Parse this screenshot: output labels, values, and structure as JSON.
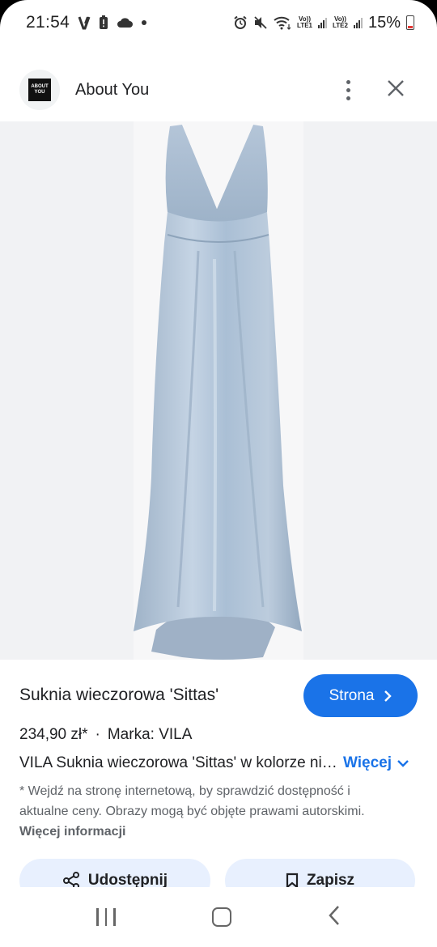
{
  "status_bar": {
    "time": "21:54",
    "left_icons": [
      "v-icon",
      "battery-alert-icon",
      "cloud-icon",
      "dot-icon"
    ],
    "right_icons": [
      "alarm-icon",
      "mute-icon",
      "wifi-icon",
      "signal-lte1",
      "signal-lte2",
      "battery-icon"
    ],
    "lte1_top": "Vo))",
    "lte1_bottom": "LTE1",
    "lte2_top": "Vo))",
    "lte2_bottom": "LTE2",
    "battery_percent": "15%"
  },
  "header": {
    "logo_text": "ABOUT YOU",
    "site_name": "About You",
    "more_icon": "more-vert-icon",
    "close_icon": "close-icon"
  },
  "product_image": {
    "subject": "dress",
    "color": "#a9bdd3"
  },
  "product": {
    "title": "Suknia wieczorowa 'Sittas'",
    "visit_label": "Strona",
    "price": "234,90 zł*",
    "separator": "·",
    "brand": "Marka: VILA",
    "description": "VILA Suknia wieczorowa 'Sittas' w kolorze niebieski",
    "more_label": "Więcej",
    "disclaimer": "* Wejdź na stronę internetową, by sprawdzić dostępność i aktualne ceny. Obrazy mogą być objęte prawami autorskimi.",
    "disclaimer_link": "Więcej informacji",
    "share_label": "Udostępnij",
    "save_label": "Zapisz"
  },
  "colors": {
    "accent": "#1a73e8",
    "chip_bg": "#e8f0fe",
    "image_bg": "#f1f2f4"
  },
  "nav_bar": {
    "icons": [
      "recent-apps-icon",
      "home-icon",
      "back-icon"
    ]
  }
}
